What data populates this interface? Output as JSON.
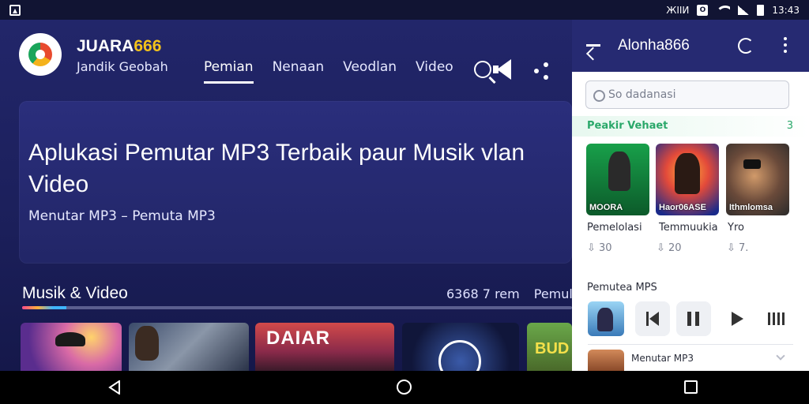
{
  "status_bar": {
    "carrier": "ЖIIИ",
    "box_label": "O",
    "time": "13:43"
  },
  "header": {
    "brand_prefix": "JUARA",
    "brand_suffix": "666",
    "brand_sub": "Jandik Geobah",
    "tabs": [
      "Pemian",
      "Nenaan",
      "Veodlan",
      "Video"
    ],
    "active_tab": 0
  },
  "hero": {
    "title": "Aplukasi Pemutar MP3 Terbaik paur Musik vlan Video",
    "subtitle": "Menutar MP3 – Pemuta MP3"
  },
  "section": {
    "title": "Musik & Video",
    "meta": "6368 7 rem",
    "meta2": "Pemul",
    "progress": 0.08
  },
  "thumbnails": {
    "t3_text": "DAIAR",
    "t5_text": "BUD"
  },
  "panel": {
    "title": "Alonha866",
    "search_placeholder": "So dadanasi",
    "section_label": "Peakir Vehaet",
    "section_count": "3",
    "cards": [
      {
        "overlay": "MOORA",
        "label": "Pemelolasi",
        "stat": "30",
        "stat_icon": "thumb-icon"
      },
      {
        "overlay": "Haor06ASE",
        "label": "Temmuukia",
        "stat": "20",
        "stat_icon": "thumb-icon"
      },
      {
        "overlay": "Ithmlomsa",
        "label": "Yro",
        "stat": "7.",
        "stat_icon": "thumb-icon"
      }
    ],
    "player_title": "Pemutea MPS",
    "row_title": "Menutar MP3"
  },
  "colors": {
    "app_bg": "#1b1f5a",
    "panel_header": "#262a72",
    "accent_green": "#2aa86a",
    "brand_accent": "#f4c21b"
  }
}
